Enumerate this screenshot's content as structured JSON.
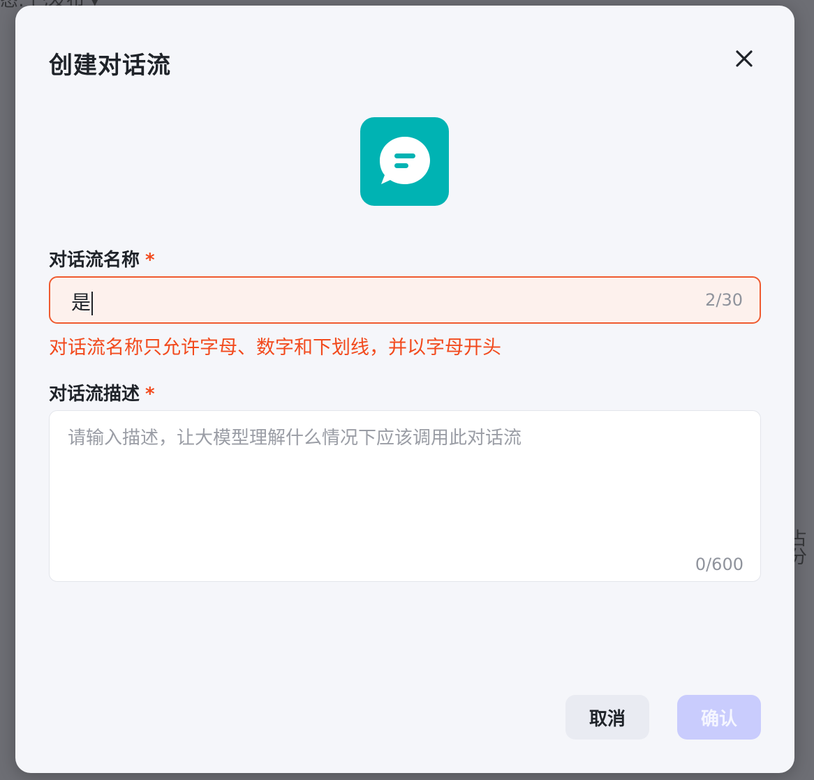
{
  "background": {
    "top_left_text": "态: 已发布 ▾",
    "right_edge_text": "占分"
  },
  "dialog": {
    "title": "创建对话流",
    "close_icon": "close-icon",
    "app_icon": "chat-bubble-icon",
    "name_field": {
      "label": "对话流名称",
      "required_mark": "*",
      "value": "是",
      "counter": "2/30",
      "error": "对话流名称只允许字母、数字和下划线，并以字母开头"
    },
    "description_field": {
      "label": "对话流描述",
      "required_mark": "*",
      "placeholder": "请输入描述，让大模型理解什么情况下应该调用此对话流",
      "counter": "0/600"
    },
    "buttons": {
      "cancel": "取消",
      "confirm": "确认"
    }
  },
  "colors": {
    "overlay": "#6d6e74",
    "dialog_bg": "#f5f6fa",
    "icon_bg": "#00b3b3",
    "error": "#f24a1d",
    "confirm_disabled": "#c9ccfd"
  }
}
